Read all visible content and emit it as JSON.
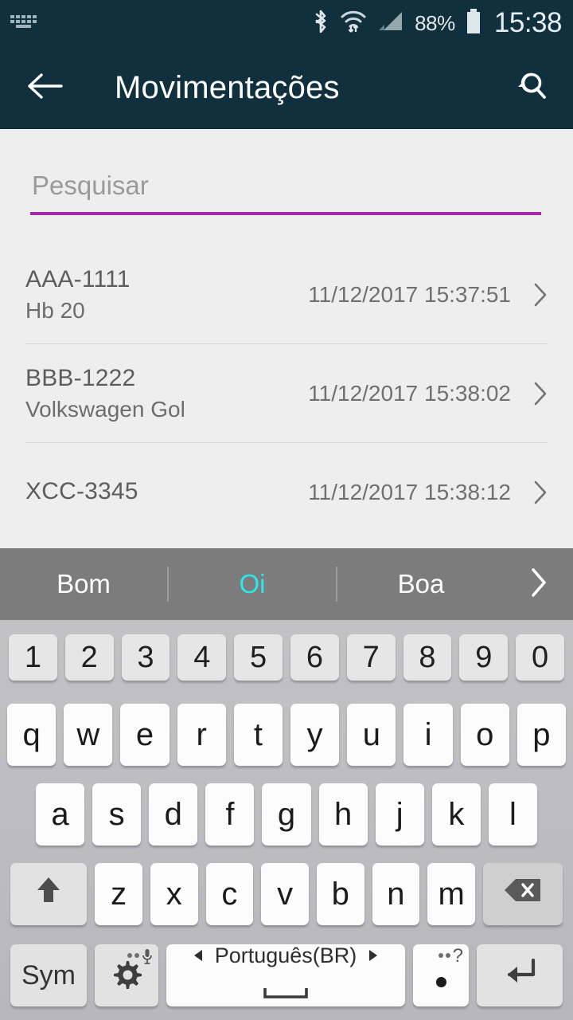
{
  "status_bar": {
    "keyboard_notification_icon": "keyboard-icon",
    "bluetooth_icon": "bluetooth-icon",
    "wifi_icon": "wifi-icon",
    "signal_icon": "cellular-signal-icon",
    "battery_percent": "88%",
    "battery_icon": "battery-icon",
    "clock": "15:38"
  },
  "app_bar": {
    "back_icon": "arrow-left-icon",
    "title": "Movimentações",
    "search_icon": "search-history-icon"
  },
  "search": {
    "value": "",
    "placeholder": "Pesquisar",
    "underline_color": "#a32ba8"
  },
  "list": {
    "rows": [
      {
        "plate": "AAA-1111",
        "model": "Hb 20",
        "timestamp": "11/12/2017 15:37:51",
        "chevron": "chevron-right-icon"
      },
      {
        "plate": "BBB-1222",
        "model": "Volkswagen Gol",
        "timestamp": "11/12/2017 15:38:02",
        "chevron": "chevron-right-icon"
      },
      {
        "plate": "XCC-3345",
        "model": "",
        "timestamp": "11/12/2017 15:38:12",
        "chevron": "chevron-right-icon"
      }
    ]
  },
  "suggestions": {
    "items": [
      {
        "label": "Bom",
        "active": false
      },
      {
        "label": "Oi",
        "active": true
      },
      {
        "label": "Boa",
        "active": false
      }
    ],
    "expand_icon": "chevron-right-icon",
    "active_color": "#2ee6ea"
  },
  "keyboard": {
    "number_row": [
      "1",
      "2",
      "3",
      "4",
      "5",
      "6",
      "7",
      "8",
      "9",
      "0"
    ],
    "row_q": [
      "q",
      "w",
      "e",
      "r",
      "t",
      "y",
      "u",
      "i",
      "o",
      "p"
    ],
    "row_a": [
      "a",
      "s",
      "d",
      "f",
      "g",
      "h",
      "j",
      "k",
      "l"
    ],
    "row_z": [
      "z",
      "x",
      "c",
      "v",
      "b",
      "n",
      "m"
    ],
    "shift_icon": "shift-arrow-up-icon",
    "backspace_icon": "backspace-delete-icon",
    "sym_label": "Sym",
    "settings_icon": "gear-microphone-icon",
    "space_prev_icon": "triangle-left-icon",
    "space_language": "Português(BR)",
    "space_next_icon": "triangle-right-icon",
    "space_bar_icon": "spacebar-icon",
    "period_label": ".",
    "period_hint": "?",
    "enter_icon": "enter-return-icon"
  }
}
